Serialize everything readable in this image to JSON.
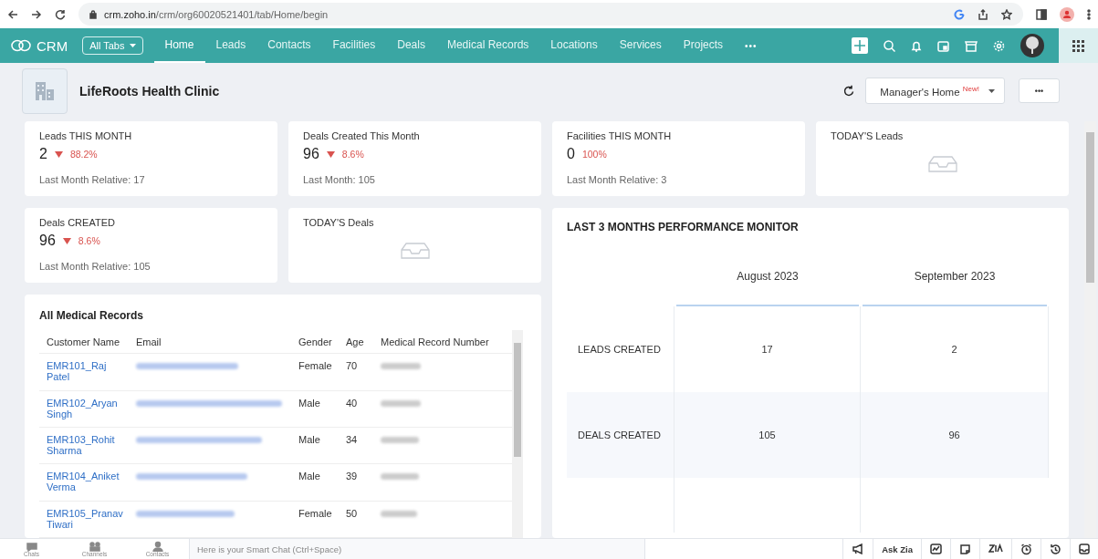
{
  "browser": {
    "url_host": "crm.zoho.in",
    "url_path": "/crm/org60020521401/tab/Home/begin"
  },
  "nav": {
    "brand": "CRM",
    "all_tabs": "All Tabs",
    "more": "•••",
    "tabs": [
      {
        "label": "Home",
        "selected": true
      },
      {
        "label": "Leads",
        "selected": false
      },
      {
        "label": "Contacts",
        "selected": false
      },
      {
        "label": "Facilities",
        "selected": false
      },
      {
        "label": "Deals",
        "selected": false
      },
      {
        "label": "Medical Records",
        "selected": false
      },
      {
        "label": "Locations",
        "selected": false
      },
      {
        "label": "Services",
        "selected": false
      },
      {
        "label": "Projects",
        "selected": false
      }
    ]
  },
  "header": {
    "title": "LifeRoots Health Clinic",
    "home_selector": {
      "label": "Manager's Home",
      "badge": "New!"
    },
    "more": "•••"
  },
  "cards": [
    {
      "kind": "metric",
      "title": "Leads THIS MONTH",
      "value": "2",
      "decreasing": true,
      "change": "88.2%",
      "footer": "Last Month Relative: 17"
    },
    {
      "kind": "metric",
      "title": "Deals Created This Month",
      "value": "96",
      "decreasing": true,
      "change": "8.6%",
      "footer": "Last Month: 105"
    },
    {
      "kind": "metric",
      "title": "Facilities THIS MONTH",
      "value": "0",
      "decreasing": false,
      "change": "100%",
      "footer": "Last Month Relative: 3"
    },
    {
      "kind": "empty",
      "title": "TODAY'S Leads"
    },
    {
      "kind": "metric",
      "title": "Deals CREATED",
      "value": "96",
      "decreasing": true,
      "change": "8.6%",
      "footer": "Last Month Relative: 105"
    },
    {
      "kind": "empty",
      "title": "TODAY'S Deals"
    }
  ],
  "records": {
    "title": "All Medical Records",
    "columns": [
      "Customer Name",
      "Email",
      "Gender",
      "Age",
      "Medical Record Number"
    ],
    "rows": [
      {
        "name": "EMR101_Raj Patel",
        "gender": "Female",
        "age": "70"
      },
      {
        "name": "EMR102_Aryan Singh",
        "gender": "Male",
        "age": "40"
      },
      {
        "name": "EMR103_Rohit Sharma",
        "gender": "Male",
        "age": "34"
      },
      {
        "name": "EMR104_Aniket Verma",
        "gender": "Male",
        "age": "39"
      },
      {
        "name": "EMR105_Pranav Tiwari",
        "gender": "Female",
        "age": "50"
      }
    ]
  },
  "performance": {
    "title": "LAST 3 MONTHS PERFORMANCE MONITOR",
    "columns": [
      "August 2023",
      "September 2023"
    ],
    "rows": [
      {
        "label": "LEADS CREATED",
        "values": [
          "17",
          "2"
        ]
      },
      {
        "label": "DEALS CREATED",
        "values": [
          "105",
          "96"
        ]
      }
    ]
  },
  "footer": {
    "shortcuts": [
      "Chats",
      "Channels",
      "Contacts"
    ],
    "chat_placeholder": "Here is your Smart Chat (Ctrl+Space)",
    "ask_zia": "Ask Zia"
  }
}
